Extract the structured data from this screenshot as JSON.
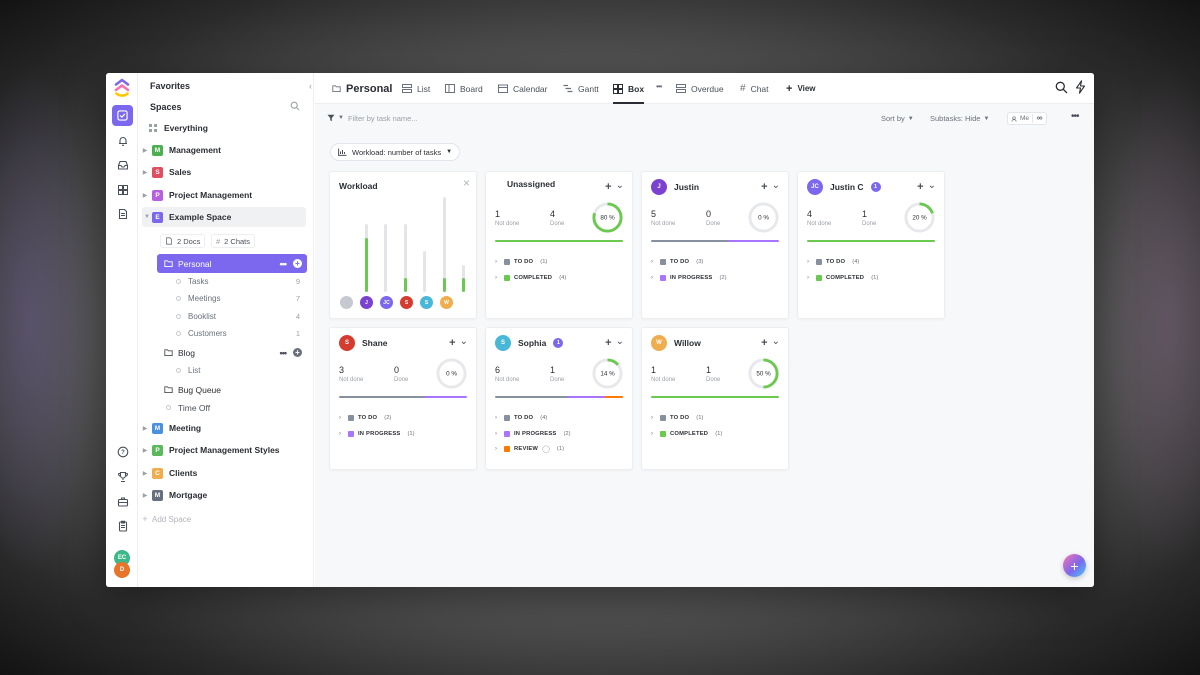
{
  "sidebar": {
    "favorites": "Favorites",
    "spaces": "Spaces",
    "everything": "Everything",
    "spaces_list": [
      {
        "letter": "M",
        "label": "Management",
        "color": "#4caf50"
      },
      {
        "letter": "S",
        "label": "Sales",
        "color": "#e04f5f"
      },
      {
        "letter": "P",
        "label": "Project Management",
        "color": "#b660e0"
      },
      {
        "letter": "E",
        "label": "Example Space",
        "color": "#7b68ee"
      }
    ],
    "docs_pill": "2 Docs",
    "chats_pill": "2 Chats",
    "personal": "Personal",
    "personal_lists": [
      {
        "label": "Tasks",
        "count": "9"
      },
      {
        "label": "Meetings",
        "count": "7"
      },
      {
        "label": "Booklist",
        "count": "4"
      },
      {
        "label": "Customers",
        "count": "1"
      }
    ],
    "blog": "Blog",
    "blog_list": "List",
    "bug_queue": "Bug Queue",
    "time_off": "Time Off",
    "spaces_list_2": [
      {
        "letter": "M",
        "label": "Meeting",
        "color": "#4a90e2"
      },
      {
        "letter": "P",
        "label": "Project Management Styles",
        "color": "#5cb85c"
      },
      {
        "letter": "C",
        "label": "Clients",
        "color": "#f0ad4e"
      },
      {
        "letter": "M",
        "label": "Mortgage",
        "color": "#656f7d"
      }
    ],
    "add_space": "Add Space"
  },
  "rail": {
    "avatars": [
      {
        "initials": "EC",
        "color": "#3db88b"
      },
      {
        "initials": "D",
        "color": "#e8742a"
      }
    ]
  },
  "toolbar": {
    "title": "Personal",
    "tabs": [
      "List",
      "Board",
      "Calendar",
      "Gantt",
      "Box",
      "Overdue",
      "Chat"
    ],
    "add_view": "View"
  },
  "filter": {
    "placeholder": "Filter by task name...",
    "sort": "Sort by",
    "subtasks": "Subtasks: Hide",
    "me": "Me"
  },
  "workload_button": "Workload: number of tasks",
  "workload_card": {
    "title": "Workload",
    "bars": [
      {
        "total": 0,
        "done": 0
      },
      {
        "total": 5,
        "done": 4
      },
      {
        "total": 5,
        "done": 0
      },
      {
        "total": 5,
        "done": 1
      },
      {
        "total": 3,
        "done": 0
      },
      {
        "total": 7,
        "done": 1
      },
      {
        "total": 2,
        "done": 1
      }
    ],
    "avatars": [
      {
        "initials": "",
        "color": "#c6cad0"
      },
      {
        "initials": "J",
        "color": "#7b42d1"
      },
      {
        "initials": "JC",
        "color": "#7b68ee"
      },
      {
        "initials": "S",
        "color": "#d63b2f"
      },
      {
        "initials": "S",
        "color": "#49b8d8"
      },
      {
        "initials": "W",
        "color": "#f0ad4e"
      }
    ]
  },
  "members": [
    {
      "name": "Unassigned",
      "initials": "",
      "color": "",
      "badge": "",
      "not_done": "1",
      "not_done_label": "Not done",
      "done": "4",
      "done_label": "Done",
      "percent": "80 %",
      "pct": 80,
      "bar": [
        {
          "color": "#6bc950",
          "pct": 100
        }
      ],
      "groups": [
        {
          "label": "TO DO",
          "count": "(1)",
          "color": "#87909e"
        },
        {
          "label": "COMPLETED",
          "count": "(4)",
          "color": "#6bc950"
        }
      ]
    },
    {
      "name": "Justin",
      "initials": "J",
      "color": "#7b42d1",
      "badge": "",
      "not_done": "5",
      "not_done_label": "Not done",
      "done": "0",
      "done_label": "Done",
      "percent": "0 %",
      "pct": 0,
      "bar": [
        {
          "color": "#87909e",
          "pct": 60
        },
        {
          "color": "#a875ff",
          "pct": 40
        }
      ],
      "groups": [
        {
          "label": "TO DO",
          "count": "(3)",
          "color": "#87909e"
        },
        {
          "label": "IN PROGRESS",
          "count": "(2)",
          "color": "#a875ff"
        }
      ]
    },
    {
      "name": "Justin C",
      "initials": "JC",
      "color": "#7b68ee",
      "badge": "1",
      "not_done": "4",
      "not_done_label": "Not done",
      "done": "1",
      "done_label": "Done",
      "percent": "20 %",
      "pct": 20,
      "bar": [
        {
          "color": "#6bc950",
          "pct": 100
        }
      ],
      "groups": [
        {
          "label": "TO DO",
          "count": "(4)",
          "color": "#87909e"
        },
        {
          "label": "COMPLETED",
          "count": "(1)",
          "color": "#6bc950"
        }
      ]
    },
    {
      "name": "Shane",
      "initials": "S",
      "color": "#d63b2f",
      "badge": "",
      "not_done": "3",
      "not_done_label": "Not done",
      "done": "0",
      "done_label": "Done",
      "percent": "0 %",
      "pct": 0,
      "bar": [
        {
          "color": "#87909e",
          "pct": 67
        },
        {
          "color": "#a875ff",
          "pct": 33
        }
      ],
      "groups": [
        {
          "label": "TO DO",
          "count": "(2)",
          "color": "#87909e"
        },
        {
          "label": "IN PROGRESS",
          "count": "(1)",
          "color": "#a875ff"
        }
      ]
    },
    {
      "name": "Sophia",
      "initials": "S",
      "color": "#49b8d8",
      "badge": "1",
      "not_done": "6",
      "not_done_label": "Not done",
      "done": "1",
      "done_label": "Done",
      "percent": "14 %",
      "pct": 14,
      "bar": [
        {
          "color": "#87909e",
          "pct": 57
        },
        {
          "color": "#a875ff",
          "pct": 29
        },
        {
          "color": "#ff7800",
          "pct": 14
        }
      ],
      "groups": [
        {
          "label": "TO DO",
          "count": "(4)",
          "color": "#87909e"
        },
        {
          "label": "IN PROGRESS",
          "count": "(2)",
          "color": "#a875ff"
        },
        {
          "label": "REVIEW",
          "count": "(1)",
          "color": "#ff7800"
        }
      ]
    },
    {
      "name": "Willow",
      "initials": "W",
      "color": "#f0ad4e",
      "badge": "",
      "not_done": "1",
      "not_done_label": "Not done",
      "done": "1",
      "done_label": "Done",
      "percent": "50 %",
      "pct": 50,
      "bar": [
        {
          "color": "#6bc950",
          "pct": 100
        }
      ],
      "groups": [
        {
          "label": "TO DO",
          "count": "(1)",
          "color": "#87909e"
        },
        {
          "label": "COMPLETED",
          "count": "(1)",
          "color": "#6bc950"
        }
      ]
    }
  ]
}
